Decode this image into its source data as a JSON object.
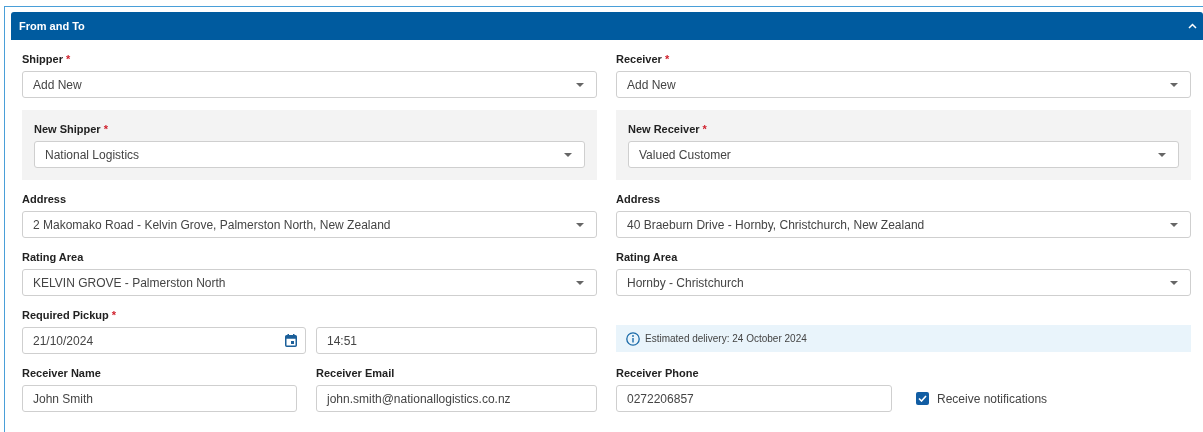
{
  "panel": {
    "title": "From and To",
    "expanded": true
  },
  "rows": [
    {
      "cells": [
        {
          "kind": "select",
          "label": "Shipper",
          "required_mark": "*",
          "value": "Add New"
        },
        {
          "kind": "select",
          "label": "Receiver",
          "required_mark": "*",
          "value": "Add New"
        }
      ]
    },
    {
      "cells": [
        {
          "kind": "subpanel_select",
          "label": "New Shipper",
          "required_mark": "*",
          "value": "National Logistics"
        },
        {
          "kind": "subpanel_select",
          "label": "New Receiver",
          "required_mark": "*",
          "value": "Valued Customer"
        }
      ]
    },
    {
      "cells": [
        {
          "kind": "select",
          "label": "Address",
          "value": "2 Makomako Road - Kelvin Grove, Palmerston North, New Zealand"
        },
        {
          "kind": "select",
          "label": "Address",
          "value": "40 Braeburn Drive - Hornby, Christchurch, New Zealand"
        }
      ]
    },
    {
      "cells": [
        {
          "kind": "select",
          "label": "Rating Area",
          "value": "KELVIN GROVE - Palmerston North"
        },
        {
          "kind": "select",
          "label": "Rating Area",
          "value": "Hornby - Christchurch"
        }
      ]
    },
    {
      "cells": [
        {
          "kind": "datetime",
          "label": "Required Pickup",
          "required_mark": "*",
          "date": "21/10/2024",
          "time": "14:51"
        },
        {
          "kind": "info",
          "text": "Estimated delivery: 24 October 2024"
        }
      ]
    },
    {
      "cells": [
        {
          "kind": "text_pair",
          "fields": [
            {
              "label": "Receiver Name",
              "value": "John Smith"
            },
            {
              "label": "Receiver Email",
              "value": "john.smith@nationallogistics.co.nz"
            }
          ]
        },
        {
          "kind": "text_check",
          "label": "Receiver Phone",
          "value": "0272206857",
          "checkbox": {
            "label": "Receive notifications",
            "checked": true
          }
        }
      ]
    }
  ]
}
